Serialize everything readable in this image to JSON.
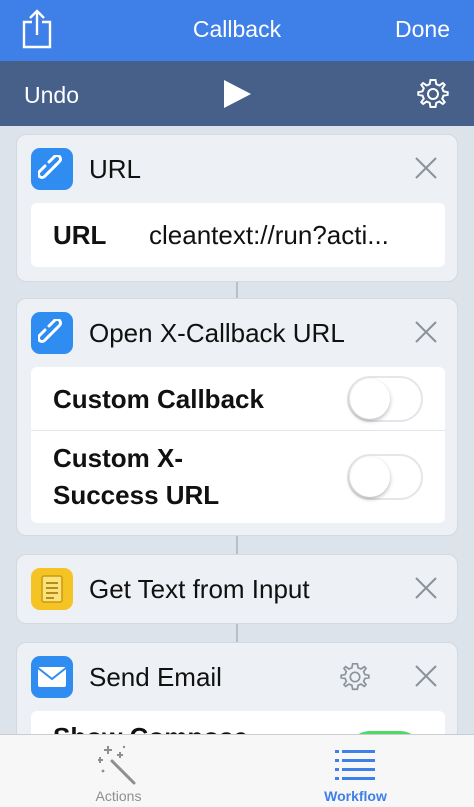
{
  "nav": {
    "title": "Callback",
    "done_label": "Done"
  },
  "toolbar": {
    "undo_label": "Undo"
  },
  "actions": [
    {
      "title": "URL",
      "icon": "link-icon",
      "fields": [
        {
          "label": "URL",
          "value": "cleantext://run?acti..."
        }
      ]
    },
    {
      "title": "Open X-Callback URL",
      "icon": "link-icon",
      "options": [
        {
          "label": "Custom Callback",
          "on": false
        },
        {
          "label": "Custom X-Success URL",
          "line1": "Custom X-",
          "line2": "Success URL",
          "on": false
        }
      ]
    },
    {
      "title": "Get Text from Input",
      "icon": "note-icon"
    },
    {
      "title": "Send Email",
      "icon": "envelope-icon",
      "options": [
        {
          "label": "Show Compose",
          "on": true
        }
      ]
    }
  ],
  "tabs": [
    {
      "label": "Actions",
      "icon": "magic-wand-icon",
      "selected": false
    },
    {
      "label": "Workflow",
      "icon": "list-icon",
      "selected": true
    }
  ],
  "colors": {
    "nav": "#3f7fe8",
    "toolbar": "#46608a",
    "accent": "#3f7fe8",
    "toggle_on": "#4cd964"
  }
}
